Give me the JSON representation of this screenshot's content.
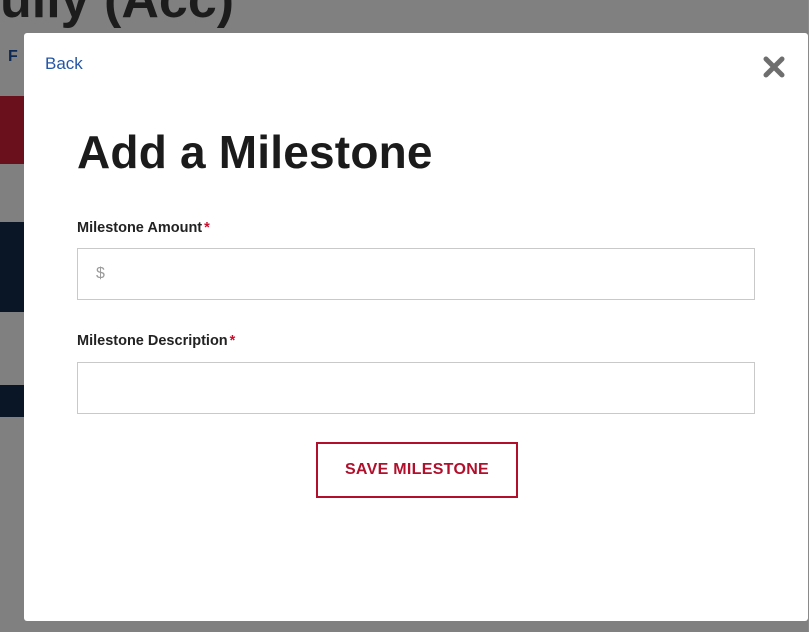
{
  "modal": {
    "back_label": "Back",
    "title": "Add a Milestone",
    "amount": {
      "label": "Milestone Amount",
      "required_mark": "*",
      "value": "",
      "placeholder": "$"
    },
    "description": {
      "label": "Milestone Description",
      "required_mark": "*",
      "value": "",
      "placeholder": ""
    },
    "save_label": "SAVE MILESTONE",
    "close_icon": "close-icon"
  },
  "colors": {
    "accent_red": "#b0102c",
    "link_blue": "#2456a6",
    "required_red": "#c8102e"
  }
}
